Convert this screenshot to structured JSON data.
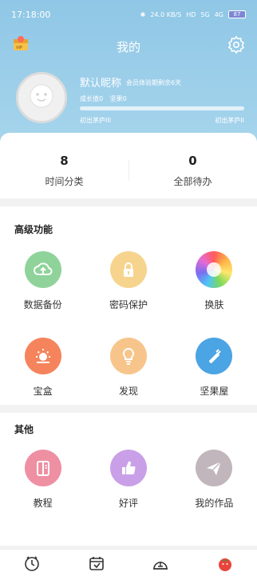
{
  "status_bar": {
    "time": "17:18:00",
    "network": "24.0 KB/S",
    "hd": "HD",
    "signal1": "5G",
    "signal2": "4G",
    "battery": "87"
  },
  "header": {
    "title": "我的"
  },
  "profile": {
    "nickname": "默认昵称",
    "member_text": "会员体验期剩余6天",
    "growth": "成长值0",
    "nuts": "坚果0",
    "level_left": "初出茅庐III",
    "level_right": "初出茅庐II",
    "progress": 0
  },
  "stats": [
    {
      "value": "8",
      "label": "时间分类"
    },
    {
      "value": "0",
      "label": "全部待办"
    }
  ],
  "advanced": {
    "title": "高级功能",
    "items": [
      {
        "label": "数据备份",
        "icon": "cloud-upload-icon",
        "color": "#8fd39a"
      },
      {
        "label": "密码保护",
        "icon": "lock-icon",
        "color": "#f6d48e"
      },
      {
        "label": "换肤",
        "icon": "color-wheel-icon",
        "color": "#ffffff"
      },
      {
        "label": "宝盒",
        "icon": "sun-icon",
        "color": "#f5845c"
      },
      {
        "label": "发现",
        "icon": "bulb-icon",
        "color": "#f7c58b"
      },
      {
        "label": "坚果屋",
        "icon": "nut-icon",
        "color": "#4ba4e3"
      }
    ]
  },
  "other": {
    "title": "其他",
    "items": [
      {
        "label": "教程",
        "icon": "book-icon",
        "color": "#ef8fa2"
      },
      {
        "label": "好评",
        "icon": "thumbs-up-icon",
        "color": "#c9a0e8"
      },
      {
        "label": "我的作品",
        "icon": "paper-plane-icon",
        "color": "#c1b6bb"
      }
    ]
  },
  "tabs": [
    {
      "name": "clock-icon"
    },
    {
      "name": "calendar-icon"
    },
    {
      "name": "dome-icon"
    },
    {
      "name": "tomato-icon"
    }
  ]
}
